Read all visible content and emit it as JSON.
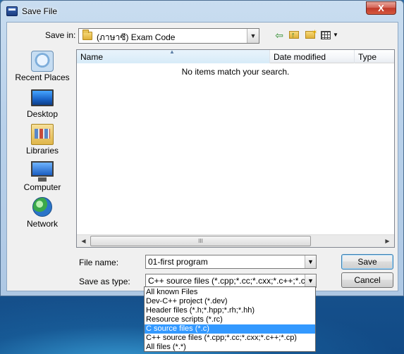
{
  "window": {
    "title": "Save File",
    "close_glyph": "X"
  },
  "toolbar": {
    "save_in_label": "Save in:",
    "save_in_value": "(ภาษาซี) Exam Code",
    "back_glyph": "⇦",
    "up_icon": "folder-up-icon",
    "new_folder_icon": "new-folder-icon",
    "views_icon": "views-menu-icon"
  },
  "places": [
    {
      "label": "Recent Places",
      "icon": "recent-places-icon"
    },
    {
      "label": "Desktop",
      "icon": "desktop-icon"
    },
    {
      "label": "Libraries",
      "icon": "libraries-icon"
    },
    {
      "label": "Computer",
      "icon": "computer-icon"
    },
    {
      "label": "Network",
      "icon": "network-icon"
    }
  ],
  "filelist": {
    "columns": [
      "Name",
      "Date modified",
      "Type"
    ],
    "sorted_column": "Name",
    "empty_message": "No items match your search.",
    "scroll_thumb_glyph": "III"
  },
  "form": {
    "file_name_label": "File name:",
    "file_name_value": "01-first program",
    "save_as_type_label": "Save as type:",
    "save_as_type_value": "C++ source files (*.cpp;*.cc;*.cxx;*.c++;*.cp)",
    "save_button": "Save",
    "cancel_button": "Cancel"
  },
  "type_dropdown": {
    "options": [
      "All known Files",
      "Dev-C++ project (*.dev)",
      "Header files (*.h;*.hpp;*.rh;*.hh)",
      "Resource scripts (*.rc)",
      "C source files (*.c)",
      "C++ source files (*.cpp;*.cc;*.cxx;*.c++;*.cp)",
      "All files (*.*)"
    ],
    "highlighted_index": 4
  },
  "colors": {
    "selection": "#3399ff",
    "desktop_background": "#1d5a94"
  }
}
